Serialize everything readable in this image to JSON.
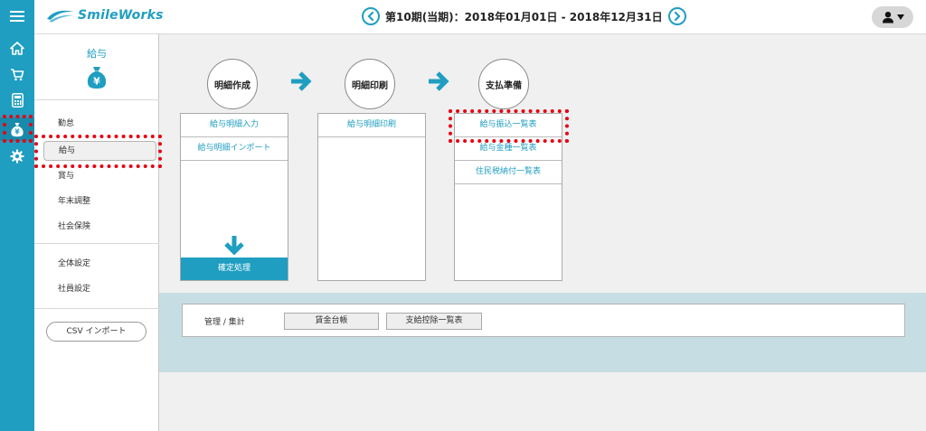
{
  "header": {
    "logo_text": "SmileWorks",
    "period_text": "第10期(当期)：2018年01月01日 - 2018年12月31日"
  },
  "rail": {
    "icons": [
      "menu-icon",
      "home-icon",
      "cart-icon",
      "calculator-icon",
      "money-bag-icon",
      "gear-icon"
    ],
    "active": "money-bag-icon"
  },
  "sidebar": {
    "title": "給与",
    "items": [
      {
        "label": "勤怠"
      },
      {
        "label": "給与"
      },
      {
        "label": "賞与"
      },
      {
        "label": "年末調整"
      },
      {
        "label": "社会保険"
      },
      {
        "label": "全体設定"
      },
      {
        "label": "社員設定"
      }
    ],
    "selected": "給与",
    "csv_button": "CSV インポート"
  },
  "flow": {
    "steps": [
      {
        "title": "明細作成",
        "items": [
          "給与明細入力",
          "給与明細インポート"
        ],
        "action": "確定処理"
      },
      {
        "title": "明細印刷",
        "items": [
          "給与明細印刷"
        ]
      },
      {
        "title": "支払準備",
        "items": [
          "給与振込一覧表",
          "給与金種一覧表",
          "住民税納付一覧表"
        ]
      }
    ]
  },
  "management": {
    "label": "管理 / 集計",
    "buttons": [
      "賃金台帳",
      "支給控除一覧表"
    ]
  },
  "colors": {
    "accent": "#1f9ec1",
    "highlight": "#e60012",
    "main_bg": "#f0f0f0",
    "band_bg": "#c6dde3"
  }
}
